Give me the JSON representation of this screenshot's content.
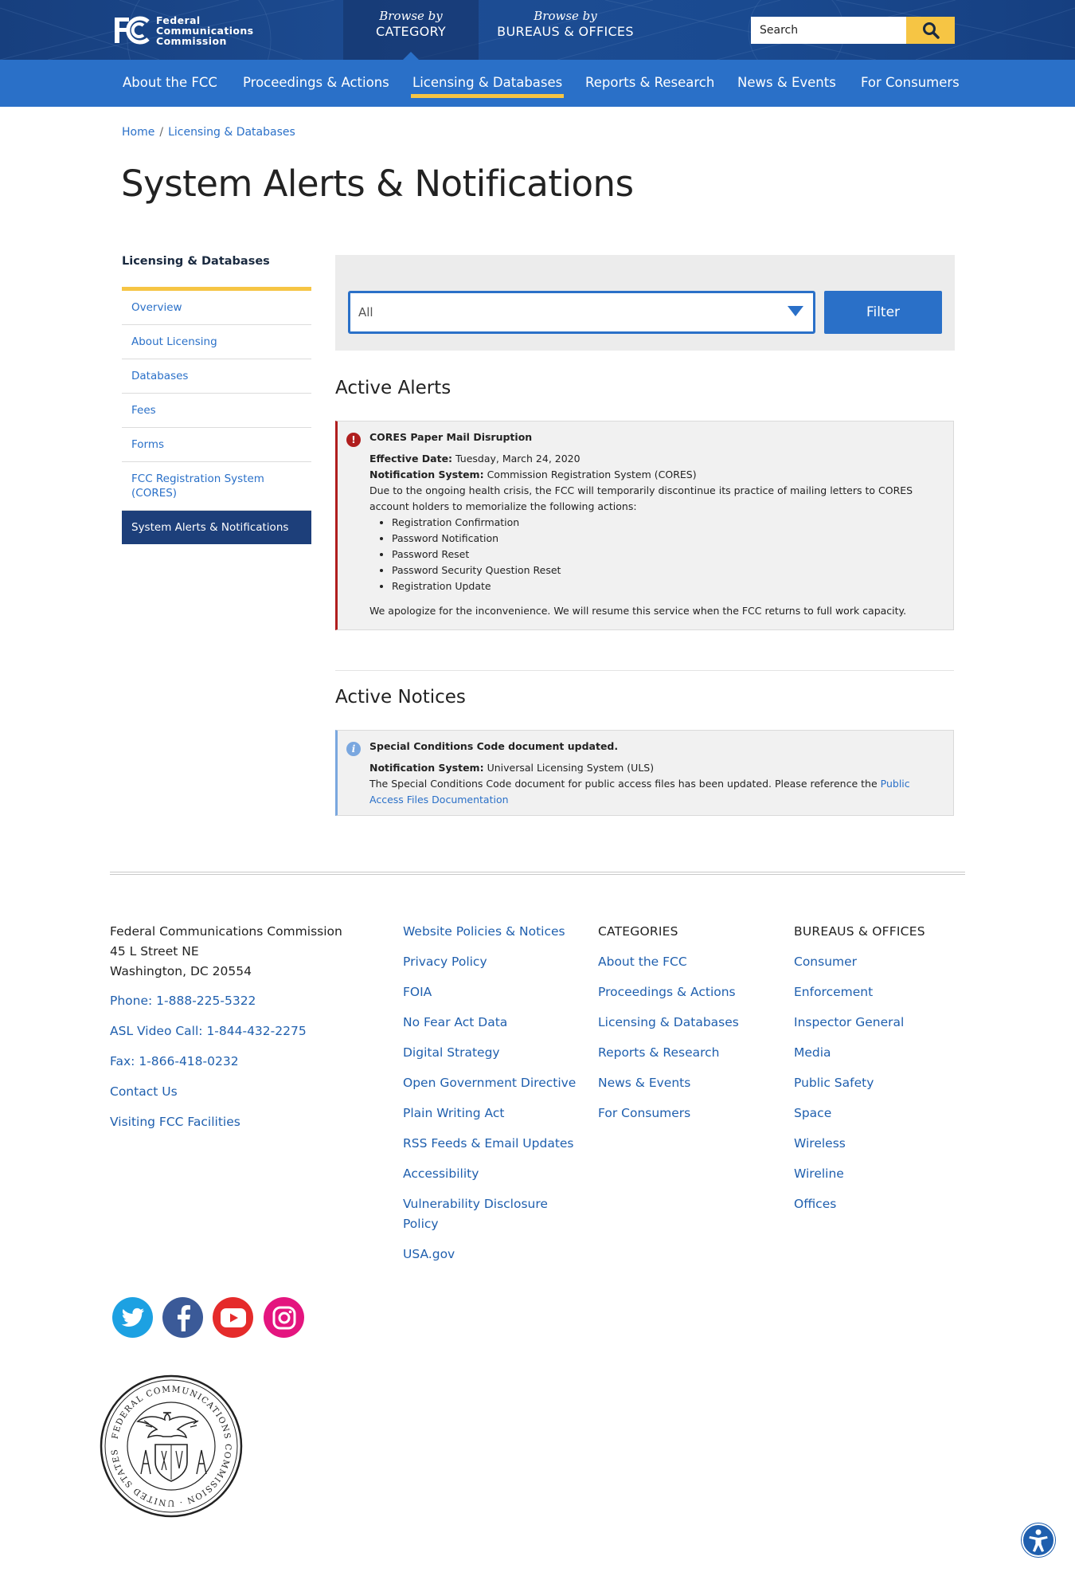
{
  "header": {
    "logo_text": [
      "Federal",
      "Communications",
      "Commission"
    ],
    "browse_category": {
      "prefix": "Browse by",
      "label": "CATEGORY"
    },
    "browse_bureaus": {
      "prefix": "Browse by",
      "label": "BUREAUS & OFFICES"
    },
    "search_placeholder": "Search",
    "colors": {
      "band": "#1d4d94",
      "nav": "#2a70c8",
      "accent": "#f6c544"
    }
  },
  "nav": {
    "items": [
      {
        "label": "About the FCC"
      },
      {
        "label": "Proceedings & Actions"
      },
      {
        "label": "Licensing & Databases"
      },
      {
        "label": "Reports & Research"
      },
      {
        "label": "News & Events"
      },
      {
        "label": "For Consumers"
      }
    ]
  },
  "breadcrumb": {
    "home": "Home",
    "sep": "/",
    "current": "Licensing & Databases"
  },
  "page_title": "System Alerts & Notifications",
  "sidebar": {
    "heading": "Licensing & Databases",
    "items": [
      {
        "label": "Overview"
      },
      {
        "label": "About Licensing"
      },
      {
        "label": "Databases"
      },
      {
        "label": "Fees"
      },
      {
        "label": "Forms"
      },
      {
        "label": "FCC Registration System (CORES)"
      },
      {
        "label": "System Alerts & Notifications"
      }
    ]
  },
  "filter": {
    "selected": "All",
    "button": "Filter"
  },
  "alerts": {
    "heading": "Active Alerts",
    "alert": {
      "icon": "exclamation-icon",
      "title": "CORES Paper Mail Disruption",
      "effective_label": "Effective Date:",
      "effective_value": "Tuesday, March 24, 2020",
      "system_label": "Notification System:",
      "system_value": "Commission Registration System (CORES)",
      "body": "Due to the ongoing health crisis, the FCC will temporarily discontinue its practice of mailing letters to CORES account holders to memorialize the following actions:",
      "list": [
        "Registration Confirmation",
        "Password Notification",
        "Password Reset",
        "Password Security Question Reset",
        "Registration Update"
      ],
      "closing": "We apologize for the inconvenience. We will resume this service when the FCC returns to full work capacity."
    }
  },
  "notices": {
    "heading": "Active Notices",
    "notice": {
      "icon": "info-icon",
      "title": "Special Conditions Code document updated.",
      "system_label": "Notification System:",
      "system_value": "Universal Licensing System (ULS)",
      "body": "The Special Conditions Code document for public access files has been updated. Please reference the",
      "link": "Public Access Files Documentation"
    }
  },
  "footer": {
    "address": {
      "org": "Federal Communications Commission",
      "street": "45 L Street NE",
      "city": "Washington, DC 20554"
    },
    "contact_links": [
      "Phone: 1-888-225-5322",
      "ASL Video Call: 1-844-432-2275",
      "Fax: 1-866-418-0232",
      "Contact Us",
      "Visiting FCC Facilities"
    ],
    "policy_links": [
      "Website Policies & Notices",
      "Privacy Policy",
      "FOIA",
      "No Fear Act Data",
      "Digital Strategy",
      "Open Government Directive",
      "Plain Writing Act",
      "RSS Feeds & Email Updates",
      "Accessibility",
      "Vulnerability Disclosure Policy",
      "USA.gov"
    ],
    "categories": {
      "heading": "CATEGORIES",
      "links": [
        "About the FCC",
        "Proceedings & Actions",
        "Licensing & Databases",
        "Reports & Research",
        "News & Events",
        "For Consumers"
      ]
    },
    "bureaus": {
      "heading": "BUREAUS & OFFICES",
      "links": [
        "Consumer",
        "Enforcement",
        "Inspector General",
        "Media",
        "Public Safety",
        "Space",
        "Wireless",
        "Wireline",
        "Offices"
      ]
    },
    "social": [
      {
        "icon": "twitter-icon",
        "color": "#1da1e2"
      },
      {
        "icon": "facebook-icon",
        "color": "#3b5a98"
      },
      {
        "icon": "youtube-icon",
        "color": "#e52b2b"
      },
      {
        "icon": "instagram-icon",
        "color": "#e4157f"
      }
    ],
    "seal_text": "FEDERAL COMMUNICATIONS COMMISSION · UNITED STATES"
  }
}
